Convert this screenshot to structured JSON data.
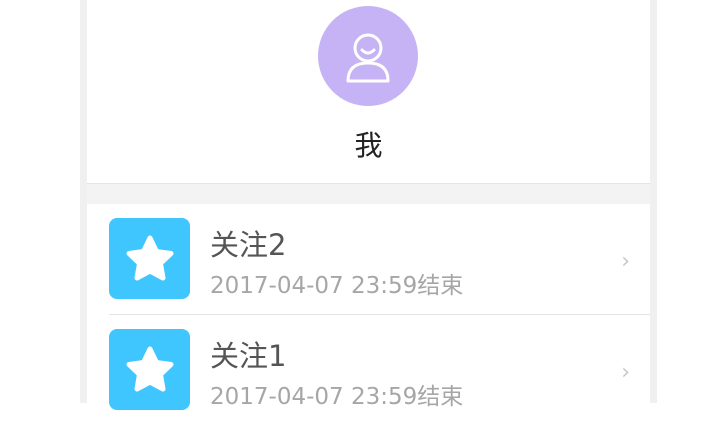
{
  "profile": {
    "name": "我",
    "avatar_icon": "user-icon",
    "avatar_color": "#c6b3f5"
  },
  "items": [
    {
      "title": "关注2",
      "subtitle": "2017-04-07 23:59结束",
      "icon": "star-icon",
      "icon_color": "#40c6ff"
    },
    {
      "title": "关注1",
      "subtitle": "2017-04-07 23:59结束",
      "icon": "star-icon",
      "icon_color": "#40c6ff"
    }
  ],
  "chevron_glyph": "›"
}
